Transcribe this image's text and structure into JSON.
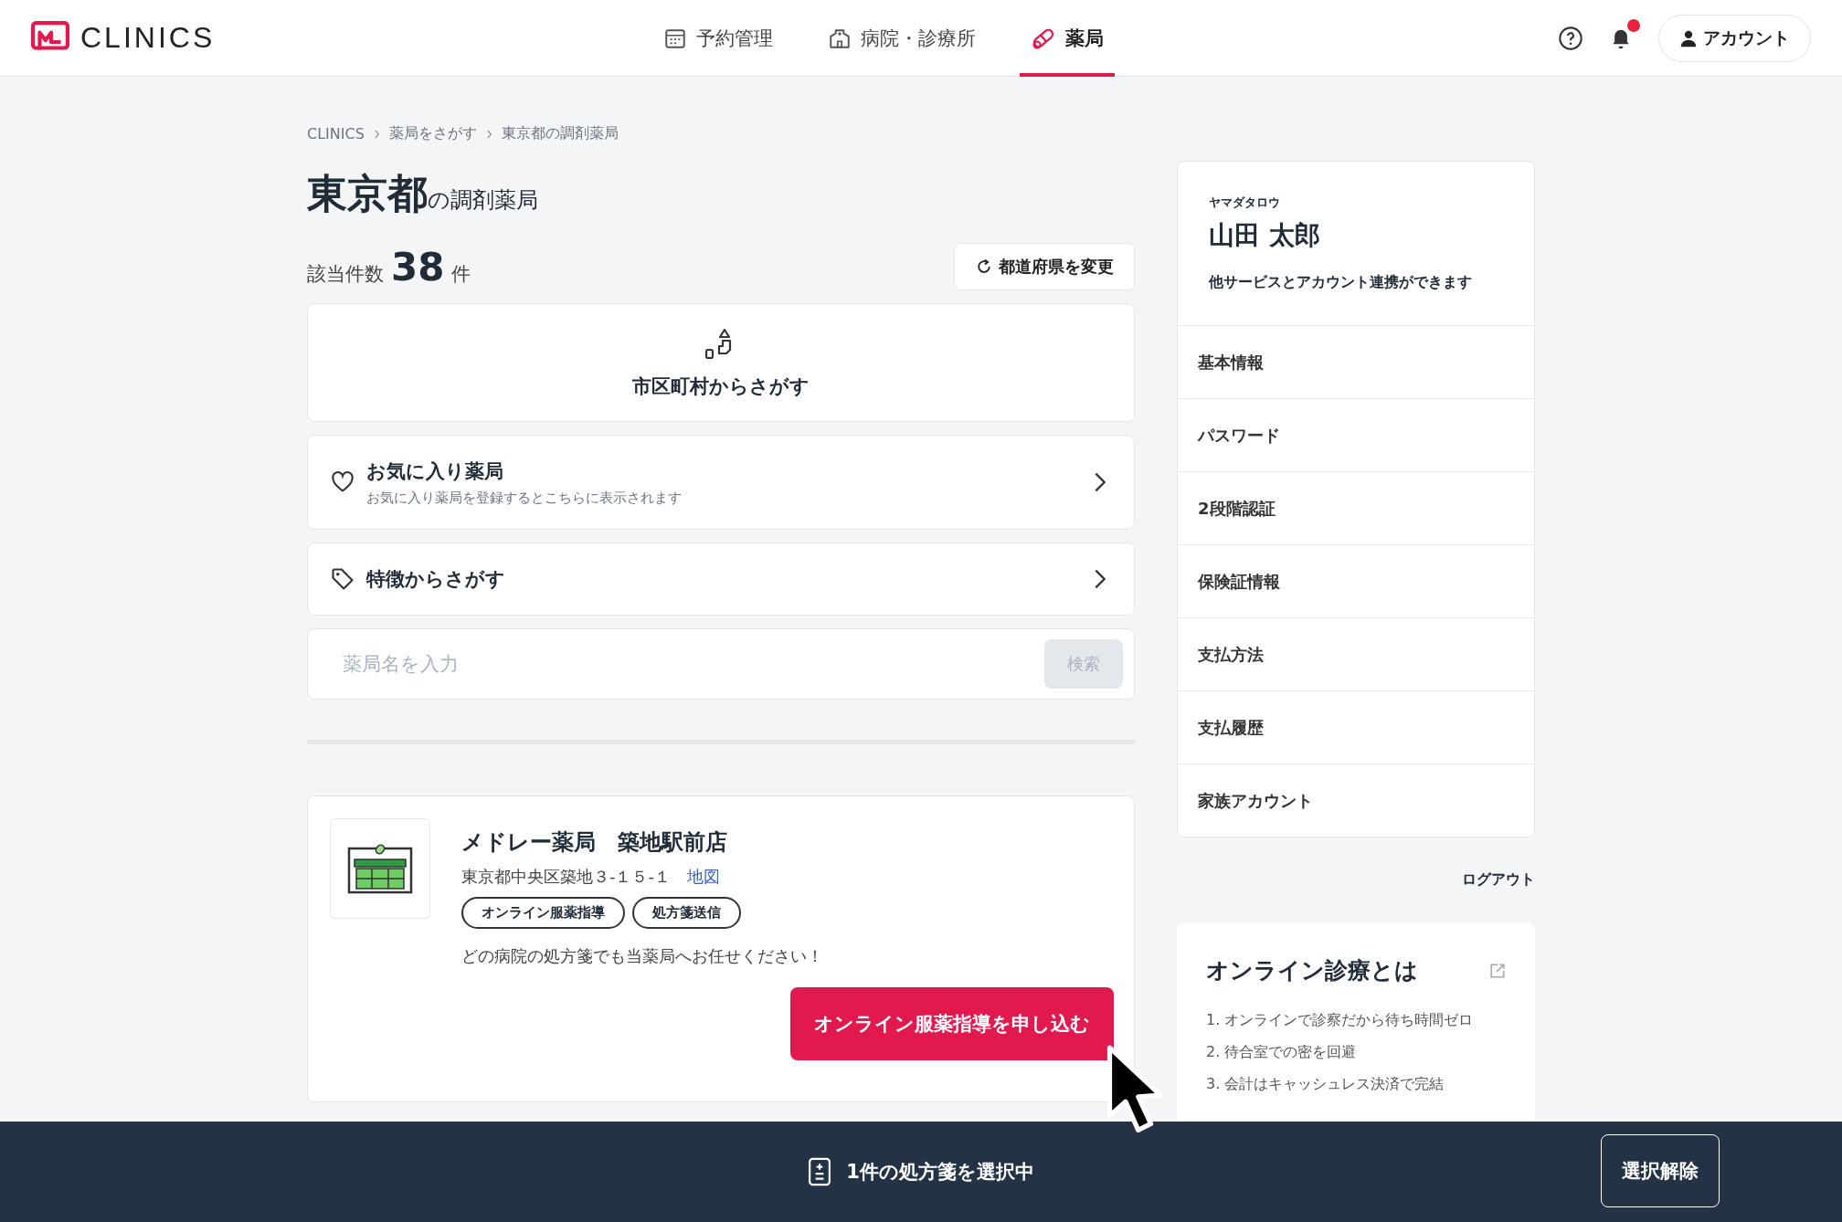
{
  "header": {
    "logo": "CLINICS",
    "nav": [
      {
        "label": "予約管理",
        "kind": "calendar",
        "selected": false
      },
      {
        "label": "病院・診療所",
        "kind": "hospital",
        "selected": false
      },
      {
        "label": "薬局",
        "kind": "pill",
        "selected": true
      }
    ],
    "notifications": {
      "unread": true
    },
    "account_button": "アカウント"
  },
  "breadcrumb": [
    "CLINICS",
    "薬局をさがす",
    "東京都の調剤薬局"
  ],
  "title": {
    "prefecture": "東京都",
    "suffix": "の調剤薬局"
  },
  "count": {
    "label": "該当件数",
    "value": "38",
    "unit": "件"
  },
  "change_prefecture_button": "都道府県を変更",
  "city_search": {
    "label": "市区町村からさがす"
  },
  "favorites": {
    "title": "お気に入り薬局",
    "description": "お気に入り薬局を登録するとこちらに表示されます"
  },
  "feature_search": {
    "title": "特徴からさがす"
  },
  "name_search": {
    "placeholder": "薬局名を入力",
    "button": "検索"
  },
  "pharmacy": {
    "name": "メドレー薬局　築地駅前店",
    "address": "東京都中央区築地３-１５-１",
    "map_link": "地図",
    "tags": [
      "オンライン服薬指導",
      "処方箋送信"
    ],
    "message": "どの病院の処方箋でも当薬局へお任せください！",
    "apply_button": "オンライン服薬指導を申し込む"
  },
  "profile": {
    "kana": "ヤマダタロウ",
    "name": "山田 太郎",
    "note": "他サービスとアカウント連携ができます",
    "menu": [
      "基本情報",
      "パスワード",
      "2段階認証",
      "保険証情報",
      "支払方法",
      "支払履歴",
      "家族アカウント"
    ],
    "logout": "ログアウト"
  },
  "info_card": {
    "title": "オンライン診療とは",
    "items": [
      "1. オンラインで診察だから待ち時間ゼロ",
      "2. 待合室での密を回避",
      "3. 会計はキャッシュレス決済で完結"
    ]
  },
  "selection_bar": {
    "text": "1件の処方箋を選択中",
    "clear_button": "選択解除"
  }
}
